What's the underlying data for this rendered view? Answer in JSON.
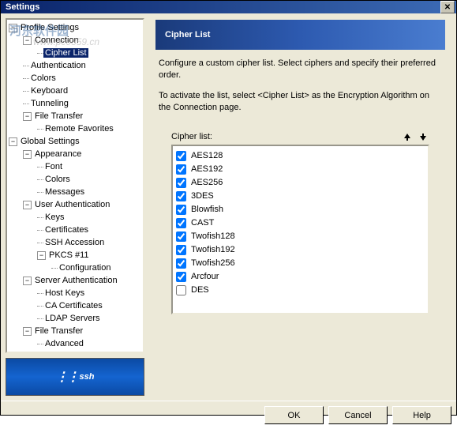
{
  "window": {
    "title": "Settings"
  },
  "watermark": {
    "main": "河东软件园",
    "url": "www.pc0359.cn"
  },
  "tree": [
    {
      "level": 0,
      "expander": "-",
      "label": "Profile Settings"
    },
    {
      "level": 1,
      "expander": "-",
      "label": "Connection"
    },
    {
      "level": 2,
      "expander": "",
      "label": "Cipher List",
      "selected": true
    },
    {
      "level": 1,
      "expander": "",
      "label": "Authentication"
    },
    {
      "level": 1,
      "expander": "",
      "label": "Colors"
    },
    {
      "level": 1,
      "expander": "",
      "label": "Keyboard"
    },
    {
      "level": 1,
      "expander": "",
      "label": "Tunneling"
    },
    {
      "level": 1,
      "expander": "-",
      "label": "File Transfer"
    },
    {
      "level": 2,
      "expander": "",
      "label": "Remote Favorites"
    },
    {
      "level": 0,
      "expander": "-",
      "label": "Global Settings"
    },
    {
      "level": 1,
      "expander": "-",
      "label": "Appearance"
    },
    {
      "level": 2,
      "expander": "",
      "label": "Font"
    },
    {
      "level": 2,
      "expander": "",
      "label": "Colors"
    },
    {
      "level": 2,
      "expander": "",
      "label": "Messages"
    },
    {
      "level": 1,
      "expander": "-",
      "label": "User Authentication"
    },
    {
      "level": 2,
      "expander": "",
      "label": "Keys"
    },
    {
      "level": 2,
      "expander": "",
      "label": "Certificates"
    },
    {
      "level": 2,
      "expander": "",
      "label": "SSH Accession"
    },
    {
      "level": 2,
      "expander": "-",
      "label": "PKCS #11"
    },
    {
      "level": 3,
      "expander": "",
      "label": "Configuration"
    },
    {
      "level": 1,
      "expander": "-",
      "label": "Server Authentication"
    },
    {
      "level": 2,
      "expander": "",
      "label": "Host Keys"
    },
    {
      "level": 2,
      "expander": "",
      "label": "CA Certificates"
    },
    {
      "level": 2,
      "expander": "",
      "label": "LDAP Servers"
    },
    {
      "level": 1,
      "expander": "-",
      "label": "File Transfer"
    },
    {
      "level": 2,
      "expander": "",
      "label": "Advanced"
    }
  ],
  "header": {
    "title": "Cipher List"
  },
  "description": {
    "line1": "Configure a custom cipher list. Select ciphers and specify their preferred order.",
    "line2": "To activate the list, select <Cipher List> as the Encryption Algorithm on the Connection page."
  },
  "cipherGroup": {
    "label": "Cipher list:"
  },
  "ciphers": [
    {
      "name": "AES128",
      "checked": true
    },
    {
      "name": "AES192",
      "checked": true
    },
    {
      "name": "AES256",
      "checked": true
    },
    {
      "name": "3DES",
      "checked": true
    },
    {
      "name": "Blowfish",
      "checked": true
    },
    {
      "name": "CAST",
      "checked": true
    },
    {
      "name": "Twofish128",
      "checked": true
    },
    {
      "name": "Twofish192",
      "checked": true
    },
    {
      "name": "Twofish256",
      "checked": true
    },
    {
      "name": "Arcfour",
      "checked": true
    },
    {
      "name": "DES",
      "checked": false
    }
  ],
  "logo": {
    "text": "ssh"
  },
  "buttons": {
    "ok": "OK",
    "cancel": "Cancel",
    "help": "Help"
  }
}
